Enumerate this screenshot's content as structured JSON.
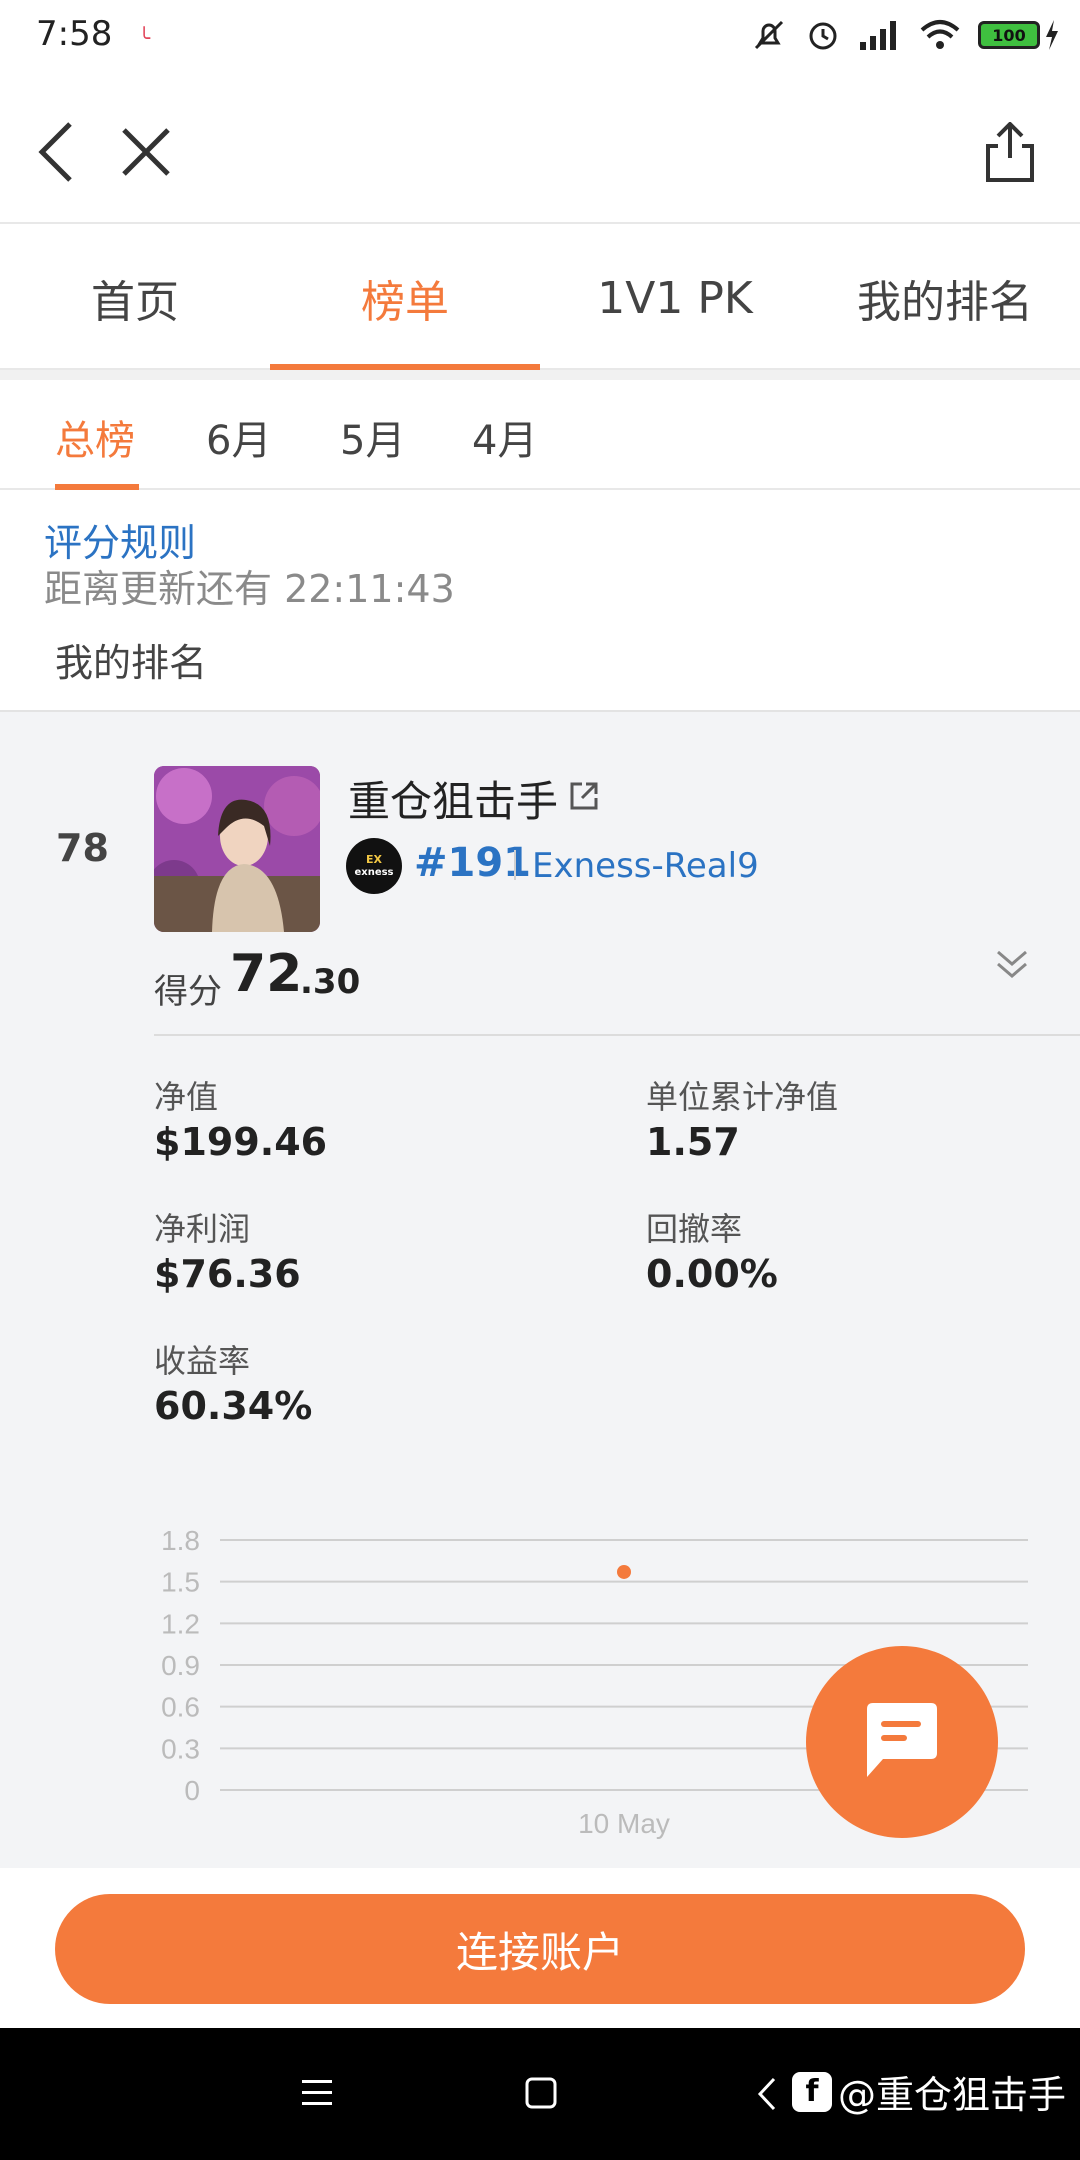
{
  "status_bar": {
    "time": "7:58",
    "battery": "100"
  },
  "tabs": [
    {
      "label": "首页",
      "active": false
    },
    {
      "label": "榜单",
      "active": true
    },
    {
      "label": "1V1 PK",
      "active": false
    },
    {
      "label": "我的排名",
      "active": false
    }
  ],
  "sub_tabs": [
    {
      "label": "总榜",
      "active": true
    },
    {
      "label": "6月",
      "active": false
    },
    {
      "label": "5月",
      "active": false
    },
    {
      "label": "4月",
      "active": false
    }
  ],
  "rules_link": "评分规则",
  "countdown": "距离更新还有 22:11:43",
  "my_rank_label": "我的排名",
  "entry": {
    "rank": "78",
    "name": "重仓狙击手",
    "broker_logo_text": "EX",
    "broker_logo_sub": "exness",
    "account_id": "#191",
    "account_server": "Exness-Real9",
    "score_label": "得分",
    "score_int": "72",
    "score_dec": ".30",
    "stats": [
      {
        "label": "净值",
        "value": "$199.46"
      },
      {
        "label": "单位累计净值",
        "value": "1.57"
      },
      {
        "label": "净利润",
        "value": "$76.36"
      },
      {
        "label": "回撤率",
        "value": "0.00%"
      },
      {
        "label": "收益率",
        "value": "60.34%"
      }
    ]
  },
  "chart_data": {
    "type": "scatter",
    "x": [
      "10 May"
    ],
    "values": [
      1.57
    ],
    "y_ticks": [
      "1.8",
      "1.5",
      "1.2",
      "0.9",
      "0.6",
      "0.3",
      "0"
    ],
    "ylim": [
      0,
      1.8
    ],
    "grid": true,
    "colors": {
      "point": "#f47a3c",
      "grid": "#cfcfcf"
    }
  },
  "connect_button": "连接账户",
  "watermark": "@重仓狙击手",
  "colors": {
    "accent": "#f47a3c",
    "link": "#2b73c3"
  }
}
